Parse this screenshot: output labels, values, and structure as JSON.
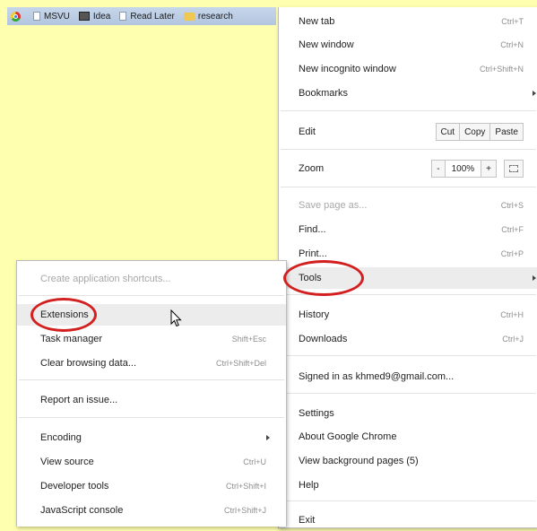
{
  "bookmarks_bar": [
    {
      "icon": "chrome-icon",
      "label": ""
    },
    {
      "icon": "page-icon",
      "label": "MSVU"
    },
    {
      "icon": "video-icon",
      "label": "Idea"
    },
    {
      "icon": "page-icon",
      "label": "Read Later"
    },
    {
      "icon": "folder-icon",
      "label": "research"
    }
  ],
  "main_menu": {
    "new_tab": {
      "label": "New tab",
      "shortcut": "Ctrl+T"
    },
    "new_window": {
      "label": "New window",
      "shortcut": "Ctrl+N"
    },
    "new_incognito": {
      "label": "New incognito window",
      "shortcut": "Ctrl+Shift+N"
    },
    "bookmarks": {
      "label": "Bookmarks"
    },
    "edit": {
      "label": "Edit",
      "cut": "Cut",
      "copy": "Copy",
      "paste": "Paste"
    },
    "zoom": {
      "label": "Zoom",
      "minus": "-",
      "value": "100%",
      "plus": "+"
    },
    "save_page": {
      "label": "Save page as...",
      "shortcut": "Ctrl+S"
    },
    "find": {
      "label": "Find...",
      "shortcut": "Ctrl+F"
    },
    "print": {
      "label": "Print...",
      "shortcut": "Ctrl+P"
    },
    "tools": {
      "label": "Tools"
    },
    "history": {
      "label": "History",
      "shortcut": "Ctrl+H"
    },
    "downloads": {
      "label": "Downloads",
      "shortcut": "Ctrl+J"
    },
    "signed_in": {
      "label": "Signed in as khmed9@gmail.com..."
    },
    "settings": {
      "label": "Settings"
    },
    "about": {
      "label": "About Google Chrome"
    },
    "background_pages": {
      "label": "View background pages (5)"
    },
    "help": {
      "label": "Help"
    },
    "exit": {
      "label": "Exit"
    }
  },
  "tools_menu": {
    "create_shortcuts": {
      "label": "Create application shortcuts..."
    },
    "extensions": {
      "label": "Extensions"
    },
    "task_manager": {
      "label": "Task manager",
      "shortcut": "Shift+Esc"
    },
    "clear_browsing": {
      "label": "Clear browsing data...",
      "shortcut": "Ctrl+Shift+Del"
    },
    "report_issue": {
      "label": "Report an issue..."
    },
    "encoding": {
      "label": "Encoding"
    },
    "view_source": {
      "label": "View source",
      "shortcut": "Ctrl+U"
    },
    "developer_tools": {
      "label": "Developer tools",
      "shortcut": "Ctrl+Shift+I"
    },
    "js_console": {
      "label": "JavaScript console",
      "shortcut": "Ctrl+Shift+J"
    }
  },
  "colors": {
    "highlight_ring": "#d21f1f",
    "page_background": "#ffffb0",
    "bookmarks_bar": "#c0d1e8"
  }
}
